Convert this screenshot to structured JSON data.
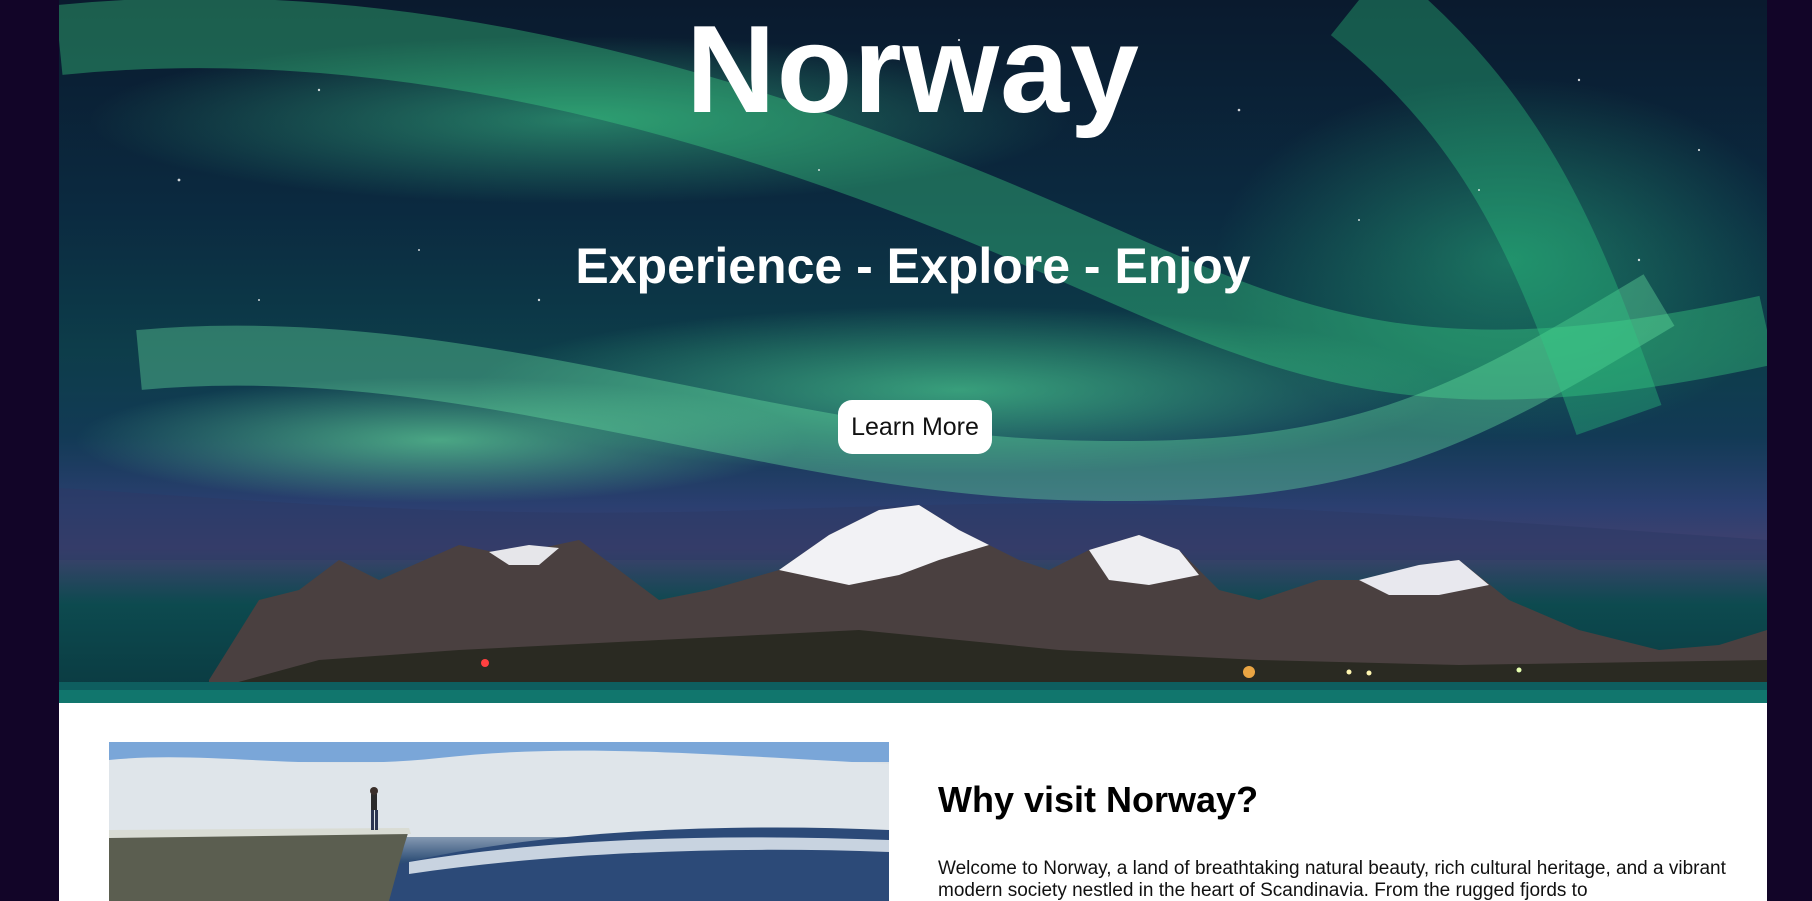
{
  "hero": {
    "title": "Norway",
    "subtitle": "Experience - Explore - Enjoy",
    "cta_label": "Learn More"
  },
  "intro": {
    "title": "Why visit Norway?",
    "text": "Welcome to Norway, a land of breathtaking natural beauty, rich cultural heritage, and a vibrant modern society nestled in the heart of Scandinavia. From the rugged fjords to"
  },
  "colors": {
    "page_background": "#120528",
    "aurora_green": "#3ee08a",
    "button_background": "#ffffff"
  }
}
